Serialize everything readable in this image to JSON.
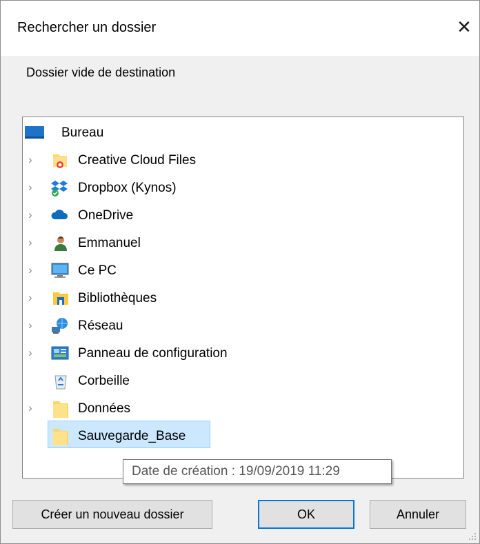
{
  "window": {
    "title": "Rechercher un dossier",
    "close_glyph": "✕"
  },
  "instruction": "Dossier vide de destination",
  "tree": {
    "items": [
      {
        "label": "Bureau",
        "icon": "desktop-icon",
        "expandable": false
      },
      {
        "label": "Creative Cloud Files",
        "icon": "creative-cloud-folder-icon",
        "expandable": true
      },
      {
        "label": "Dropbox (Kynos)",
        "icon": "dropbox-icon",
        "expandable": true
      },
      {
        "label": "OneDrive",
        "icon": "onedrive-cloud-icon",
        "expandable": true
      },
      {
        "label": "Emmanuel",
        "icon": "user-folder-icon",
        "expandable": true
      },
      {
        "label": "Ce PC",
        "icon": "computer-icon",
        "expandable": true
      },
      {
        "label": "Bibliothèques",
        "icon": "libraries-icon",
        "expandable": true
      },
      {
        "label": "Réseau",
        "icon": "network-icon",
        "expandable": true
      },
      {
        "label": "Panneau de configuration",
        "icon": "control-panel-icon",
        "expandable": true
      },
      {
        "label": "Corbeille",
        "icon": "recycle-bin-icon",
        "expandable": false
      },
      {
        "label": "Données",
        "icon": "folder-icon",
        "expandable": true
      },
      {
        "label": "Sauvegarde_Base",
        "icon": "folder-icon",
        "expandable": false,
        "selected": true
      }
    ],
    "chevron_glyph": "›"
  },
  "tooltip": "Date de création : 19/09/2019 11:29",
  "buttons": {
    "new_folder": "Créer un nouveau dossier",
    "ok": "OK",
    "cancel": "Annuler"
  },
  "colors": {
    "selection": "#cce8ff",
    "selection_border": "#99d1ff",
    "default_button_border": "#0078d7",
    "folder": "#ffd767"
  }
}
